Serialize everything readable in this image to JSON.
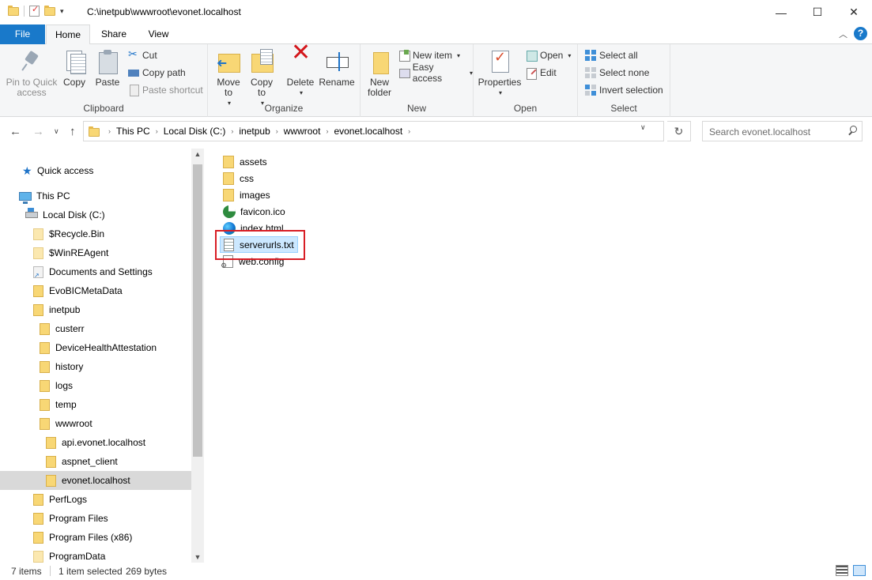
{
  "window": {
    "title": "C:\\inetpub\\wwwroot\\evonet.localhost",
    "minimize": "—",
    "maximize": "☐",
    "close": "✕"
  },
  "ribbon_tabs": [
    "File",
    "Home",
    "Share",
    "View"
  ],
  "ribbon": {
    "clipboard": {
      "label": "Clipboard",
      "pin_to_quick_access": "Pin to Quick access",
      "copy": "Copy",
      "paste": "Paste",
      "cut": "Cut",
      "copy_path": "Copy path",
      "paste_shortcut": "Paste shortcut"
    },
    "organize": {
      "label": "Organize",
      "move_to": "Move to",
      "copy_to": "Copy to",
      "delete": "Delete",
      "rename": "Rename"
    },
    "new": {
      "label": "New",
      "new_folder": "New folder",
      "new_item": "New item",
      "easy_access": "Easy access"
    },
    "open": {
      "label": "Open",
      "properties": "Properties",
      "open": "Open",
      "edit": "Edit"
    },
    "select": {
      "label": "Select",
      "select_all": "Select all",
      "select_none": "Select none",
      "invert_selection": "Invert selection"
    }
  },
  "address": {
    "crumbs": [
      "This PC",
      "Local Disk (C:)",
      "inetpub",
      "wwwroot",
      "evonet.localhost"
    ],
    "search_placeholder": "Search evonet.localhost"
  },
  "nav_tree": [
    {
      "label": "Quick access",
      "icon": "quick-access-star-icon"
    },
    {
      "label": "This PC",
      "icon": "this-pc-icon"
    },
    {
      "label": "Local Disk (C:)",
      "icon": "local-disk-icon"
    },
    {
      "label": "$Recycle.Bin",
      "icon": "folder-icon"
    },
    {
      "label": "$WinREAgent",
      "icon": "folder-icon"
    },
    {
      "label": "Documents and Settings",
      "icon": "shortcut-folder-icon"
    },
    {
      "label": "EvoBICMetaData",
      "icon": "folder-icon"
    },
    {
      "label": "inetpub",
      "icon": "folder-icon"
    },
    {
      "label": "custerr",
      "icon": "folder-icon"
    },
    {
      "label": "DeviceHealthAttestation",
      "icon": "folder-icon"
    },
    {
      "label": "history",
      "icon": "folder-icon"
    },
    {
      "label": "logs",
      "icon": "folder-icon"
    },
    {
      "label": "temp",
      "icon": "folder-icon"
    },
    {
      "label": "wwwroot",
      "icon": "folder-icon"
    },
    {
      "label": "api.evonet.localhost",
      "icon": "folder-icon"
    },
    {
      "label": "aspnet_client",
      "icon": "folder-icon"
    },
    {
      "label": "evonet.localhost",
      "icon": "folder-icon"
    },
    {
      "label": "PerfLogs",
      "icon": "folder-icon"
    },
    {
      "label": "Program Files",
      "icon": "folder-icon"
    },
    {
      "label": "Program Files (x86)",
      "icon": "folder-icon"
    },
    {
      "label": "ProgramData",
      "icon": "folder-icon"
    }
  ],
  "files": [
    {
      "name": "assets",
      "icon": "folder-icon"
    },
    {
      "name": "css",
      "icon": "folder-icon"
    },
    {
      "name": "images",
      "icon": "folder-icon"
    },
    {
      "name": "favicon.ico",
      "icon": "ico-file-icon"
    },
    {
      "name": "index.html",
      "icon": "html-file-icon"
    },
    {
      "name": "serverurls.txt",
      "icon": "text-file-icon"
    },
    {
      "name": "web.config",
      "icon": "config-file-icon"
    }
  ],
  "status": {
    "item_count": "7 items",
    "selection": "1 item selected",
    "size": "269 bytes"
  },
  "colors": {
    "accent": "#1979ca",
    "selection": "#cce8ff",
    "highlight_box": "#d81e25"
  }
}
